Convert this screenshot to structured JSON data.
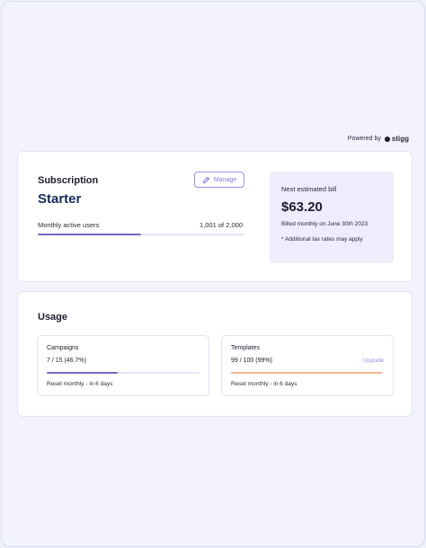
{
  "powered_by": {
    "label": "Powered by",
    "brand": "stigg"
  },
  "subscription": {
    "title": "Subscription",
    "plan": "Starter",
    "manage_label": "Manage",
    "metric_label": "Monthly active users",
    "metric_value": "1,001 of 2,000",
    "metric_progress": 0.5005
  },
  "bill": {
    "label": "Next estimated bill",
    "amount": "$63.20",
    "cycle": "Billed monthly on June 30th 2023",
    "note": "* Additional tax rates may apply"
  },
  "usage": {
    "title": "Usage",
    "items": [
      {
        "name": "Campaigns",
        "value": "7 / 15 (46.7%)",
        "progress": 0.467,
        "color": "#7a63c8",
        "reset": "Reset monthly - in 6 days",
        "action": ""
      },
      {
        "name": "Templates",
        "value": "99 / 100 (99%)",
        "progress": 0.99,
        "color": "#f2b48f",
        "reset": "Reset monthly - in 6 days",
        "action": "Upgrade"
      }
    ]
  }
}
